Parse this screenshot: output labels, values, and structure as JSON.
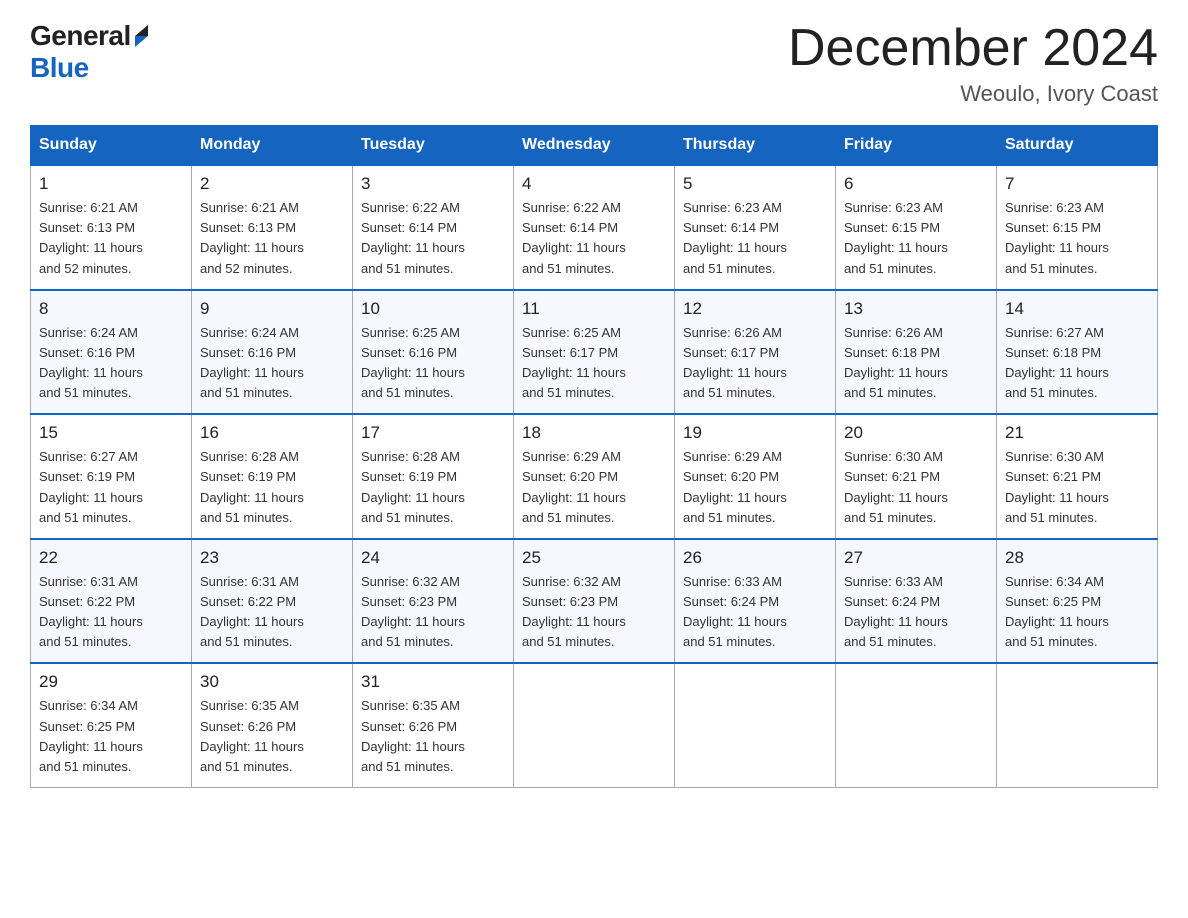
{
  "logo": {
    "general": "General",
    "blue": "Blue"
  },
  "title": "December 2024",
  "subtitle": "Weoulo, Ivory Coast",
  "days_of_week": [
    "Sunday",
    "Monday",
    "Tuesday",
    "Wednesday",
    "Thursday",
    "Friday",
    "Saturday"
  ],
  "weeks": [
    [
      {
        "day": "1",
        "info": "Sunrise: 6:21 AM\nSunset: 6:13 PM\nDaylight: 11 hours\nand 52 minutes."
      },
      {
        "day": "2",
        "info": "Sunrise: 6:21 AM\nSunset: 6:13 PM\nDaylight: 11 hours\nand 52 minutes."
      },
      {
        "day": "3",
        "info": "Sunrise: 6:22 AM\nSunset: 6:14 PM\nDaylight: 11 hours\nand 51 minutes."
      },
      {
        "day": "4",
        "info": "Sunrise: 6:22 AM\nSunset: 6:14 PM\nDaylight: 11 hours\nand 51 minutes."
      },
      {
        "day": "5",
        "info": "Sunrise: 6:23 AM\nSunset: 6:14 PM\nDaylight: 11 hours\nand 51 minutes."
      },
      {
        "day": "6",
        "info": "Sunrise: 6:23 AM\nSunset: 6:15 PM\nDaylight: 11 hours\nand 51 minutes."
      },
      {
        "day": "7",
        "info": "Sunrise: 6:23 AM\nSunset: 6:15 PM\nDaylight: 11 hours\nand 51 minutes."
      }
    ],
    [
      {
        "day": "8",
        "info": "Sunrise: 6:24 AM\nSunset: 6:16 PM\nDaylight: 11 hours\nand 51 minutes."
      },
      {
        "day": "9",
        "info": "Sunrise: 6:24 AM\nSunset: 6:16 PM\nDaylight: 11 hours\nand 51 minutes."
      },
      {
        "day": "10",
        "info": "Sunrise: 6:25 AM\nSunset: 6:16 PM\nDaylight: 11 hours\nand 51 minutes."
      },
      {
        "day": "11",
        "info": "Sunrise: 6:25 AM\nSunset: 6:17 PM\nDaylight: 11 hours\nand 51 minutes."
      },
      {
        "day": "12",
        "info": "Sunrise: 6:26 AM\nSunset: 6:17 PM\nDaylight: 11 hours\nand 51 minutes."
      },
      {
        "day": "13",
        "info": "Sunrise: 6:26 AM\nSunset: 6:18 PM\nDaylight: 11 hours\nand 51 minutes."
      },
      {
        "day": "14",
        "info": "Sunrise: 6:27 AM\nSunset: 6:18 PM\nDaylight: 11 hours\nand 51 minutes."
      }
    ],
    [
      {
        "day": "15",
        "info": "Sunrise: 6:27 AM\nSunset: 6:19 PM\nDaylight: 11 hours\nand 51 minutes."
      },
      {
        "day": "16",
        "info": "Sunrise: 6:28 AM\nSunset: 6:19 PM\nDaylight: 11 hours\nand 51 minutes."
      },
      {
        "day": "17",
        "info": "Sunrise: 6:28 AM\nSunset: 6:19 PM\nDaylight: 11 hours\nand 51 minutes."
      },
      {
        "day": "18",
        "info": "Sunrise: 6:29 AM\nSunset: 6:20 PM\nDaylight: 11 hours\nand 51 minutes."
      },
      {
        "day": "19",
        "info": "Sunrise: 6:29 AM\nSunset: 6:20 PM\nDaylight: 11 hours\nand 51 minutes."
      },
      {
        "day": "20",
        "info": "Sunrise: 6:30 AM\nSunset: 6:21 PM\nDaylight: 11 hours\nand 51 minutes."
      },
      {
        "day": "21",
        "info": "Sunrise: 6:30 AM\nSunset: 6:21 PM\nDaylight: 11 hours\nand 51 minutes."
      }
    ],
    [
      {
        "day": "22",
        "info": "Sunrise: 6:31 AM\nSunset: 6:22 PM\nDaylight: 11 hours\nand 51 minutes."
      },
      {
        "day": "23",
        "info": "Sunrise: 6:31 AM\nSunset: 6:22 PM\nDaylight: 11 hours\nand 51 minutes."
      },
      {
        "day": "24",
        "info": "Sunrise: 6:32 AM\nSunset: 6:23 PM\nDaylight: 11 hours\nand 51 minutes."
      },
      {
        "day": "25",
        "info": "Sunrise: 6:32 AM\nSunset: 6:23 PM\nDaylight: 11 hours\nand 51 minutes."
      },
      {
        "day": "26",
        "info": "Sunrise: 6:33 AM\nSunset: 6:24 PM\nDaylight: 11 hours\nand 51 minutes."
      },
      {
        "day": "27",
        "info": "Sunrise: 6:33 AM\nSunset: 6:24 PM\nDaylight: 11 hours\nand 51 minutes."
      },
      {
        "day": "28",
        "info": "Sunrise: 6:34 AM\nSunset: 6:25 PM\nDaylight: 11 hours\nand 51 minutes."
      }
    ],
    [
      {
        "day": "29",
        "info": "Sunrise: 6:34 AM\nSunset: 6:25 PM\nDaylight: 11 hours\nand 51 minutes."
      },
      {
        "day": "30",
        "info": "Sunrise: 6:35 AM\nSunset: 6:26 PM\nDaylight: 11 hours\nand 51 minutes."
      },
      {
        "day": "31",
        "info": "Sunrise: 6:35 AM\nSunset: 6:26 PM\nDaylight: 11 hours\nand 51 minutes."
      },
      {
        "day": "",
        "info": ""
      },
      {
        "day": "",
        "info": ""
      },
      {
        "day": "",
        "info": ""
      },
      {
        "day": "",
        "info": ""
      }
    ]
  ]
}
